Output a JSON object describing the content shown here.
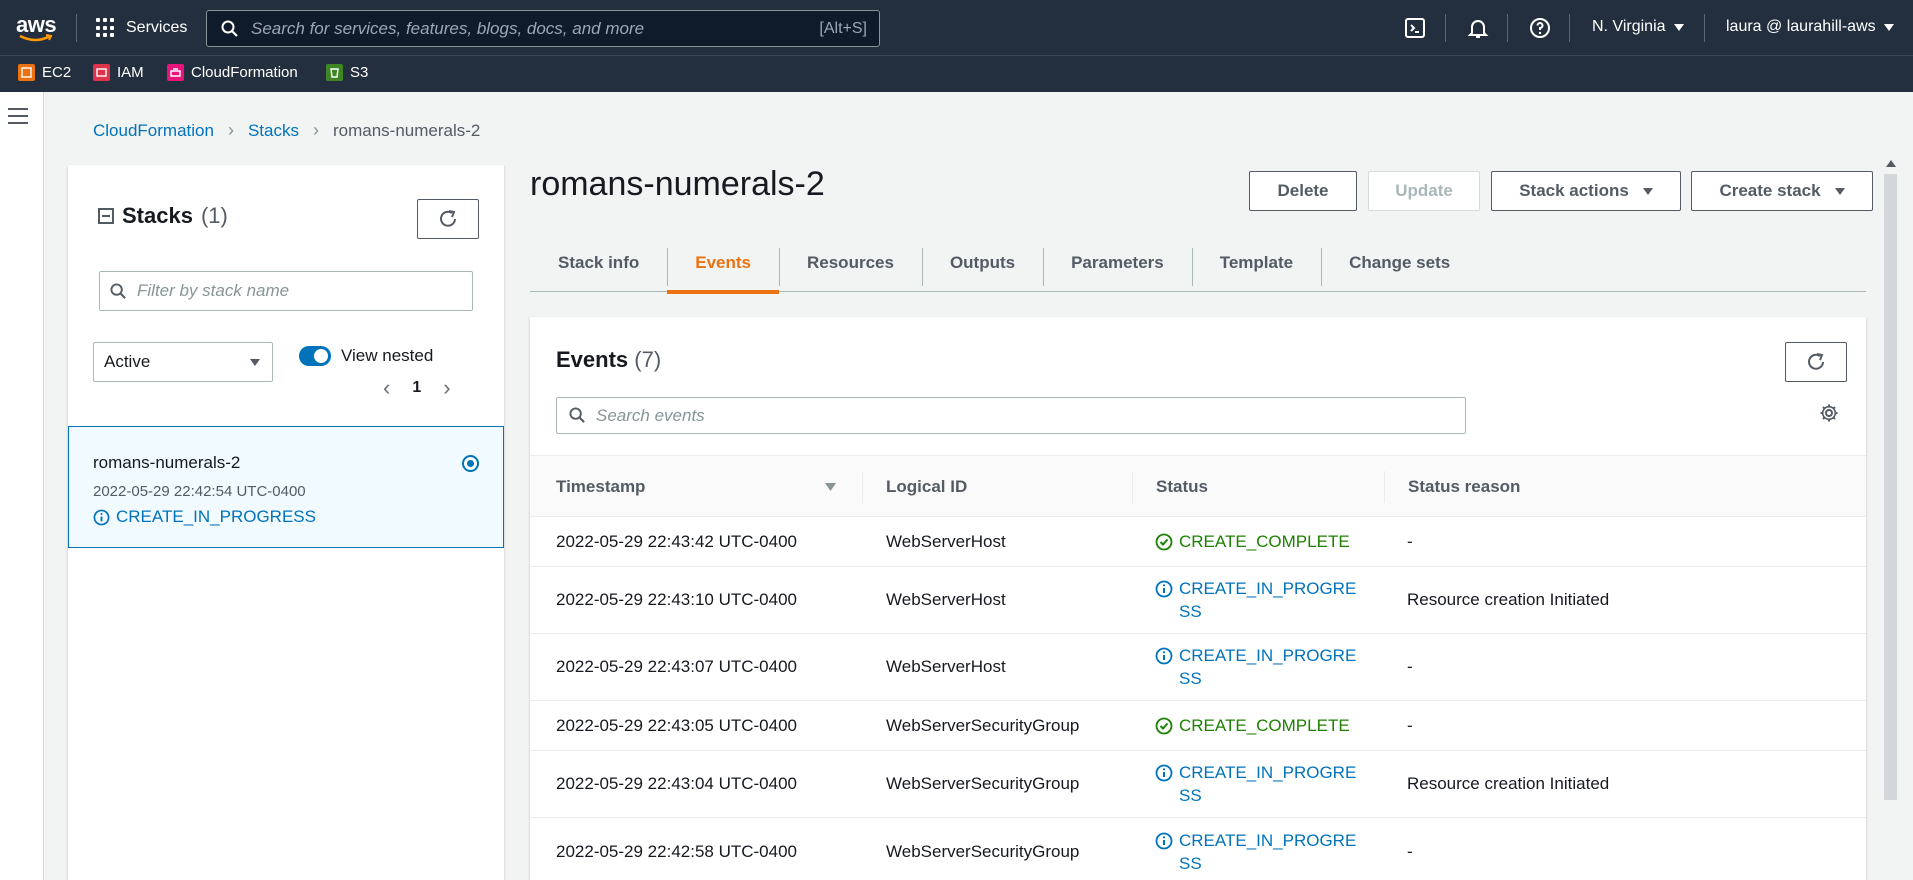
{
  "topnav": {
    "logo_text": "aws",
    "services_label": "Services",
    "search_placeholder": "Search for services, features, blogs, docs, and more",
    "search_shortcut": "[Alt+S]",
    "region_label": "N. Virginia",
    "account_label": "laura @ laurahill-aws"
  },
  "favorites": [
    {
      "label": "EC2",
      "color": "#ec7211"
    },
    {
      "label": "IAM",
      "color": "#dd344c"
    },
    {
      "label": "CloudFormation",
      "color": "#e7157b"
    },
    {
      "label": "S3",
      "color": "#3f8624"
    }
  ],
  "breadcrumb": {
    "items": [
      "CloudFormation",
      "Stacks"
    ],
    "current": "romans-numerals-2"
  },
  "stacks_panel": {
    "title": "Stacks",
    "count": "(1)",
    "filter_placeholder": "Filter by stack name",
    "status_filter": "Active",
    "view_nested_label": "View nested",
    "page": "1",
    "stack": {
      "name": "romans-numerals-2",
      "timestamp": "2022-05-29 22:42:54 UTC-0400",
      "status": "CREATE_IN_PROGRESS"
    }
  },
  "main": {
    "title": "romans-numerals-2",
    "buttons": {
      "delete": "Delete",
      "update": "Update",
      "stack_actions": "Stack actions",
      "create_stack": "Create stack"
    },
    "tabs": [
      "Stack info",
      "Events",
      "Resources",
      "Outputs",
      "Parameters",
      "Template",
      "Change sets"
    ],
    "active_tab": "Events"
  },
  "events": {
    "title": "Events",
    "count": "(7)",
    "search_placeholder": "Search events",
    "columns": [
      "Timestamp",
      "Logical ID",
      "Status",
      "Status reason"
    ],
    "rows": [
      {
        "timestamp": "2022-05-29 22:43:42 UTC-0400",
        "logical_id": "WebServerHost",
        "status": "CREATE_COMPLETE",
        "reason": "-"
      },
      {
        "timestamp": "2022-05-29 22:43:10 UTC-0400",
        "logical_id": "WebServerHost",
        "status": "CREATE_IN_PROGRESS",
        "reason": "Resource creation Initiated"
      },
      {
        "timestamp": "2022-05-29 22:43:07 UTC-0400",
        "logical_id": "WebServerHost",
        "status": "CREATE_IN_PROGRESS",
        "reason": "-"
      },
      {
        "timestamp": "2022-05-29 22:43:05 UTC-0400",
        "logical_id": "WebServerSecurityGroup",
        "status": "CREATE_COMPLETE",
        "reason": "-"
      },
      {
        "timestamp": "2022-05-29 22:43:04 UTC-0400",
        "logical_id": "WebServerSecurityGroup",
        "status": "CREATE_IN_PROGRESS",
        "reason": "Resource creation Initiated"
      },
      {
        "timestamp": "2022-05-29 22:42:58 UTC-0400",
        "logical_id": "WebServerSecurityGroup",
        "status": "CREATE_IN_PROGRESS",
        "reason": "-"
      }
    ]
  },
  "colors": {
    "nav_bg": "#232f3e",
    "link": "#0073bb",
    "active_tab": "#ec7211",
    "success": "#1d8102"
  }
}
